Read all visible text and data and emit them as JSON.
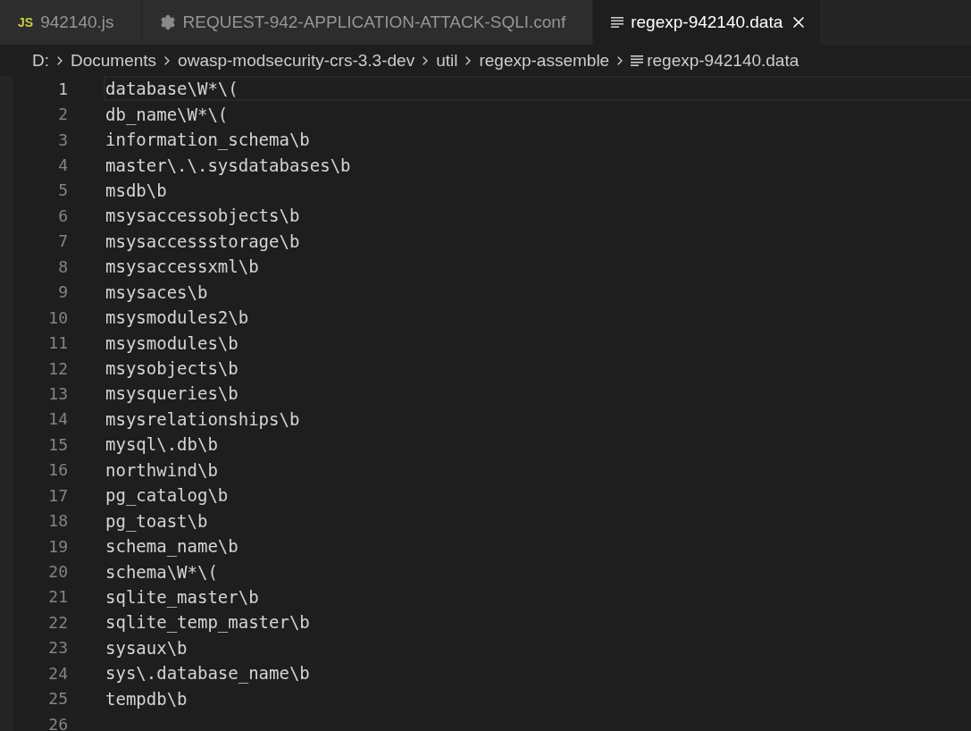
{
  "tabs": [
    {
      "label": "942140.js",
      "kind": "script",
      "badge": "JS",
      "selected": false
    },
    {
      "label": "REQUEST-942-APPLICATION-ATTACK-SQLI.conf",
      "kind": "config",
      "selected": false
    },
    {
      "label": "regexp-942140.data",
      "kind": "text",
      "selected": true
    }
  ],
  "breadcrumbs": [
    {
      "label": "D:",
      "kind": "folder"
    },
    {
      "label": "Documents",
      "kind": "folder"
    },
    {
      "label": "owasp-modsecurity-crs-3.3-dev",
      "kind": "folder"
    },
    {
      "label": "util",
      "kind": "folder"
    },
    {
      "label": "regexp-assemble",
      "kind": "folder"
    },
    {
      "label": "regexp-942140.data",
      "kind": "file"
    }
  ],
  "lines": [
    {
      "number": "1",
      "text": "database\\W*\\(",
      "current": true
    },
    {
      "number": "2",
      "text": "db_name\\W*\\(",
      "current": false
    },
    {
      "number": "3",
      "text": "information_schema\\b",
      "current": false
    },
    {
      "number": "4",
      "text": "master\\.\\.sysdatabases\\b",
      "current": false
    },
    {
      "number": "5",
      "text": "msdb\\b",
      "current": false
    },
    {
      "number": "6",
      "text": "msysaccessobjects\\b",
      "current": false
    },
    {
      "number": "7",
      "text": "msysaccessstorage\\b",
      "current": false
    },
    {
      "number": "8",
      "text": "msysaccessxml\\b",
      "current": false
    },
    {
      "number": "9",
      "text": "msysaces\\b",
      "current": false
    },
    {
      "number": "10",
      "text": "msysmodules2\\b",
      "current": false
    },
    {
      "number": "11",
      "text": "msysmodules\\b",
      "current": false
    },
    {
      "number": "12",
      "text": "msysobjects\\b",
      "current": false
    },
    {
      "number": "13",
      "text": "msysqueries\\b",
      "current": false
    },
    {
      "number": "14",
      "text": "msysrelationships\\b",
      "current": false
    },
    {
      "number": "15",
      "text": "mysql\\.db\\b",
      "current": false
    },
    {
      "number": "16",
      "text": "northwind\\b",
      "current": false
    },
    {
      "number": "17",
      "text": "pg_catalog\\b",
      "current": false
    },
    {
      "number": "18",
      "text": "pg_toast\\b",
      "current": false
    },
    {
      "number": "19",
      "text": "schema_name\\b",
      "current": false
    },
    {
      "number": "20",
      "text": "schema\\W*\\(",
      "current": false
    },
    {
      "number": "21",
      "text": "sqlite_master\\b",
      "current": false
    },
    {
      "number": "22",
      "text": "sqlite_temp_master\\b",
      "current": false
    },
    {
      "number": "23",
      "text": "sysaux\\b",
      "current": false
    },
    {
      "number": "24",
      "text": "sys\\.database_name\\b",
      "current": false
    },
    {
      "number": "25",
      "text": "tempdb\\b",
      "current": false
    },
    {
      "number": "26",
      "current": false
    }
  ]
}
